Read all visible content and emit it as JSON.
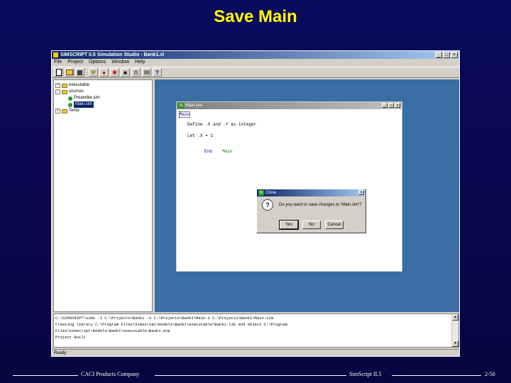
{
  "slide": {
    "title": "Save Main",
    "footer_left": "CACI Products Company",
    "footer_center": "SimScript II.5",
    "footer_right": "2-50"
  },
  "app": {
    "title": "SIMSCRIPT II.5 Simulation Studio - Bank1.sl",
    "menu": [
      "File",
      "Project",
      "Options",
      "Window",
      "Help"
    ],
    "toolbar_icons": [
      "new-icon",
      "open-icon",
      "save-icon",
      "build-icon",
      "run-icon",
      "debug-icon",
      "stop-icon",
      "options-icon",
      "print-icon",
      "help-icon"
    ],
    "tree": [
      {
        "label": "executable",
        "type": "folder"
      },
      {
        "label": "sources",
        "type": "folder"
      },
      {
        "label": "Preamble.sim",
        "type": "leaf"
      },
      {
        "label": "Main.sim",
        "type": "leaf",
        "selected": true
      },
      {
        "label": "Temp",
        "type": "folder"
      }
    ],
    "editor": {
      "title": "Main.sim",
      "lines": [
        {
          "kw": "Main",
          "rest": ""
        },
        {
          "kw": "",
          "rest": "Define .X and .Y as integer"
        },
        {
          "kw": "",
          "rest": "Let .X = 1"
        },
        {
          "kw": "End",
          "rest": "Main"
        }
      ]
    },
    "dialog": {
      "title": "Close",
      "message": "Do you want to save changes to 'Main.sim'?",
      "buttons": [
        "Yes",
        "No",
        "Cancel"
      ]
    },
    "output": [
      "C:\\SIMSCRIPT\\simc -I C:\\Projects\\Bank1 -o C:\\Projects\\Bank1\\Main.o C:\\Projects\\Bank1\\Main.sim",
      "Creating library C:\\Program Files\\Simscript\\models\\Bank1\\executable\\Bank1.lib and object C:\\Program",
      "Files\\Simscript\\models\\Bank1\\executable\\Bank1.exp",
      "Project Built"
    ],
    "status": "Ready"
  }
}
